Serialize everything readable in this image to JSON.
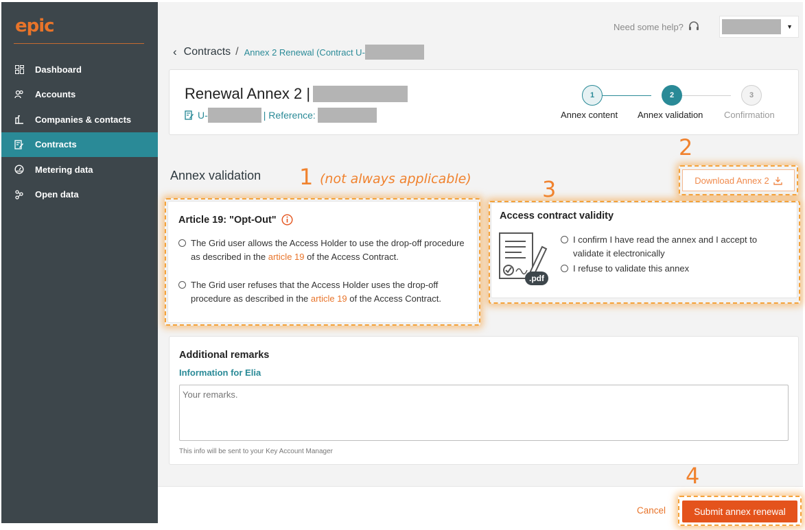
{
  "app": {
    "logo": "epic"
  },
  "sidebar": {
    "items": [
      {
        "label": "Dashboard",
        "icon": "dashboard-icon"
      },
      {
        "label": "Accounts",
        "icon": "users-icon"
      },
      {
        "label": "Companies & contacts",
        "icon": "building-icon"
      },
      {
        "label": "Contracts",
        "icon": "contract-edit-icon",
        "active": true
      },
      {
        "label": "Metering data",
        "icon": "gauge-icon"
      },
      {
        "label": "Open data",
        "icon": "network-icon"
      }
    ]
  },
  "topbar": {
    "help_text": "Need some help?",
    "help_icon": "headset-icon"
  },
  "breadcrumb": {
    "root": "Contracts",
    "separator": "/",
    "current": "Annex 2 Renewal (Contract U-"
  },
  "header": {
    "title": "Renewal Annex 2 |",
    "ref_prefix": "U-",
    "ref_label": "| Reference:",
    "steps": [
      {
        "number": "1",
        "label": "Annex content",
        "state": "done"
      },
      {
        "number": "2",
        "label": "Annex validation",
        "state": "active"
      },
      {
        "number": "3",
        "label": "Confirmation",
        "state": "pending"
      }
    ]
  },
  "section": {
    "title": "Annex validation"
  },
  "annotations": {
    "n1": "1",
    "n1_note": "(not always applicable)",
    "n2": "2",
    "n3": "3",
    "n4": "4"
  },
  "download": {
    "label": "Download Annex 2"
  },
  "article19": {
    "title": "Article 19: \"Opt-Out\"",
    "options": [
      {
        "before": "The Grid user allows the Access Holder to use the drop-off procedure as described in the",
        "link": "article 19",
        "after": "of the Access Contract."
      },
      {
        "before": "The Grid user refuses that the Access Holder uses the drop-off procedure as described in the",
        "link": "article 19",
        "after": "of the Access Contract."
      }
    ]
  },
  "validity": {
    "title": "Access contract validity",
    "pdf_badge": ".pdf",
    "options": [
      "I confirm I have read the annex and I accept to validate it electronically",
      "I refuse to validate this annex"
    ]
  },
  "remarks": {
    "title": "Additional remarks",
    "subtitle": "Information for Elia",
    "placeholder": "Your remarks.",
    "note": "This info will be sent to your Key Account Manager"
  },
  "footer": {
    "cancel": "Cancel",
    "submit": "Submit annex renewal"
  },
  "colors": {
    "sidebar": "#3d464b",
    "accent": "#2a8a97",
    "brand": "#e8742a",
    "submit": "#e4531c",
    "annotation": "#f0822e"
  }
}
